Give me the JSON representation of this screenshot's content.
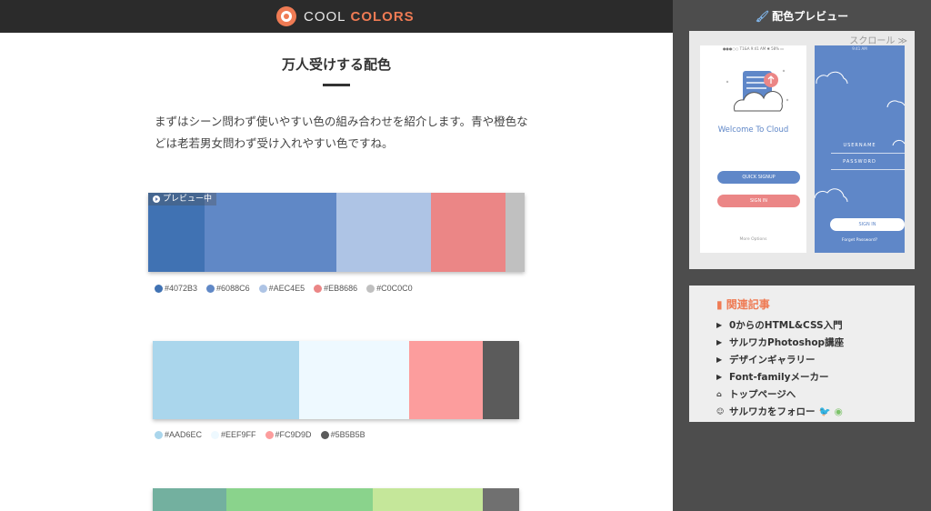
{
  "header": {
    "logo_icon": "cool-colors-logo-icon",
    "brand_word1": "COOL",
    "brand_word2": "COLORS"
  },
  "main": {
    "title": "万人受けする配色",
    "intro": "まずはシーン問わず使いやすい色の組み合わせを紹介します。青や橙色などは老若男女問わず受け入れやすい色ですね。",
    "preview_badge": "プレビュー中",
    "palettes": [
      {
        "colors": [
          "#4072B3",
          "#6088C6",
          "#AEC4E5",
          "#EB8686",
          "#C0C0C0"
        ],
        "codes": [
          "#4072B3",
          "#6088C6",
          "#AEC4E5",
          "#EB8686",
          "#C0C0C0"
        ]
      },
      {
        "colors": [
          "#AAD6EC",
          "#EEF9FF",
          "#FC9D9D",
          "#5B5B5B"
        ],
        "codes": [
          "#AAD6EC",
          "#EEF9FF",
          "#FC9D9D",
          "#5B5B5B"
        ]
      },
      {
        "colors": [
          "#73B09F",
          "#8AD38C",
          "#C5E79A",
          "#707070"
        ]
      }
    ]
  },
  "sidebar": {
    "title": "配色プレビュー",
    "title_icon": "paintbrush-icon",
    "scroll_label": "スクロール ≫",
    "preview": {
      "status1": "●●●○○ T1&A  9:41 AM  ✱ 58% ▭",
      "status2": "9:41 AM",
      "welcome": "Welcome To Cloud",
      "quick_signup": "QUICK SIGNUP",
      "sign_in": "SIGN IN",
      "more_options": "More Options",
      "username": "USERNAME",
      "password": "PASSWORD",
      "sign_in2": "SIGN IN",
      "forgot": "Forget Password?"
    },
    "related": {
      "title": "関連記事",
      "title_icon": "bookmark-icon",
      "items": [
        "0からのHTML&CSS入門",
        "サルワカPhotoshop講座",
        "デザインギャラリー",
        "Font-familyメーカー"
      ],
      "top_page": "トップページへ",
      "follow": "サルワカをフォロー"
    }
  }
}
